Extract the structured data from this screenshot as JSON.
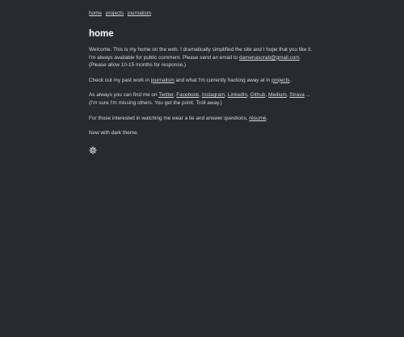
{
  "nav": {
    "home": "home",
    "projects": "projects",
    "journalism": "journalism"
  },
  "title": "home",
  "intro": {
    "text1": "Welcome. This is my home on the web. I dramatically simplified the site and I hope that you like it. I'm always available for public comment. Please send an email to ",
    "email": "damenasorab@gmail.com",
    "text2": ". (Please allow 10-15 months for response.)"
  },
  "work": {
    "text1": "Check out my past work in ",
    "journalism_link": "journalism",
    "text2": " and what I'm currently hacking away at in ",
    "projects_link": "projects",
    "text3": "."
  },
  "social": {
    "text1": "As always you can find me on ",
    "links": [
      "Twitter",
      "Facebook",
      "Instagram",
      "LinkedIn",
      "Github",
      "Medium",
      "Strava"
    ],
    "text2": "... (I'm sure I'm missing others. You get the point. Troll away.)"
  },
  "resume": {
    "text1": "For those interested in watching me wear a tie and answer questions, ",
    "link": "résumé",
    "text2": "."
  },
  "theme_note": "Now with dark theme.",
  "icons": {
    "settings": "gear-icon"
  }
}
